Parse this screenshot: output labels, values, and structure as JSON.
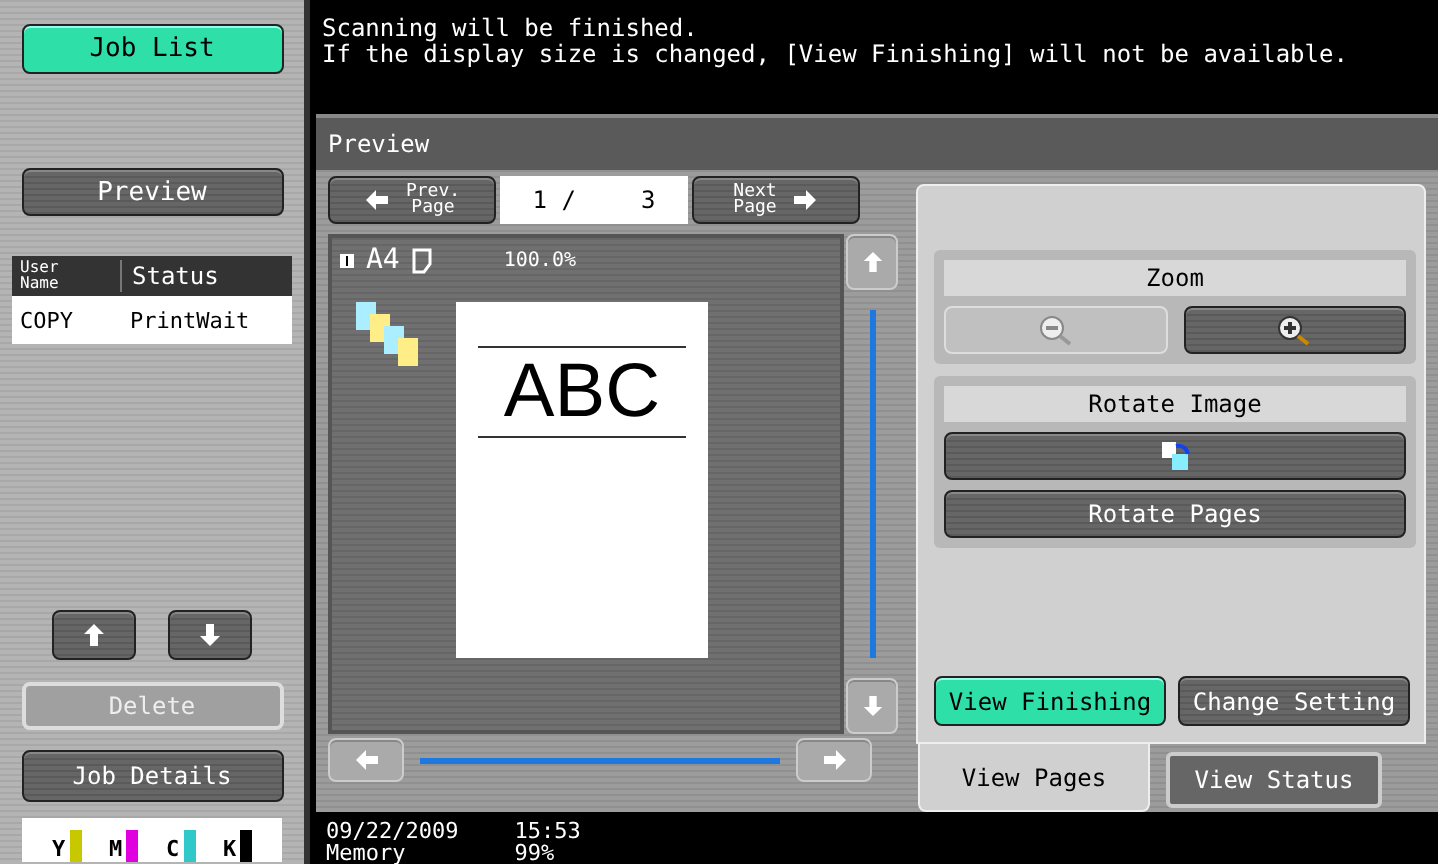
{
  "message": [
    "Scanning will be finished.",
    "If the display size is changed, [View Finishing] will not be available."
  ],
  "sidebar": {
    "job_list": {
      "label": "Job List",
      "selected": true
    },
    "preview": {
      "label": "Preview"
    },
    "table": {
      "columns": [
        [
          "User",
          "Name"
        ],
        "Status"
      ],
      "rows": [
        {
          "cells": [
            "COPY",
            "PrintWait"
          ],
          "selected": true
        }
      ]
    },
    "delete": {
      "label": "Delete",
      "disabled": true
    },
    "job_details": {
      "label": "Job Details"
    },
    "toner": [
      {
        "label": "Y",
        "color": "#c8c800"
      },
      {
        "label": "M",
        "color": "#e000e0"
      },
      {
        "label": "C",
        "color": "#30c8c8"
      },
      {
        "label": "K",
        "color": "#000000"
      }
    ]
  },
  "preview": {
    "title": "Preview",
    "prev": [
      "Prev.",
      "Page"
    ],
    "next": [
      "Next",
      "Page"
    ],
    "page": "1 /",
    "total": "3",
    "paper": "A4",
    "scale": "100.0%",
    "document_text": "ABC",
    "zoom_label": "Zoom",
    "rotate_label": "Rotate Image",
    "rotate_pages": "Rotate Pages",
    "actions": [
      {
        "label": "View Finishing",
        "selected": true
      },
      {
        "label": "Change Setting",
        "selected": false
      }
    ],
    "tabs": [
      {
        "label": "View Pages",
        "selected": true
      },
      {
        "label": "View Status",
        "selected": false
      }
    ]
  },
  "status_bar": {
    "date": "09/22/2009",
    "time": "15:53",
    "memory_label": "Memory",
    "memory": "99%"
  }
}
